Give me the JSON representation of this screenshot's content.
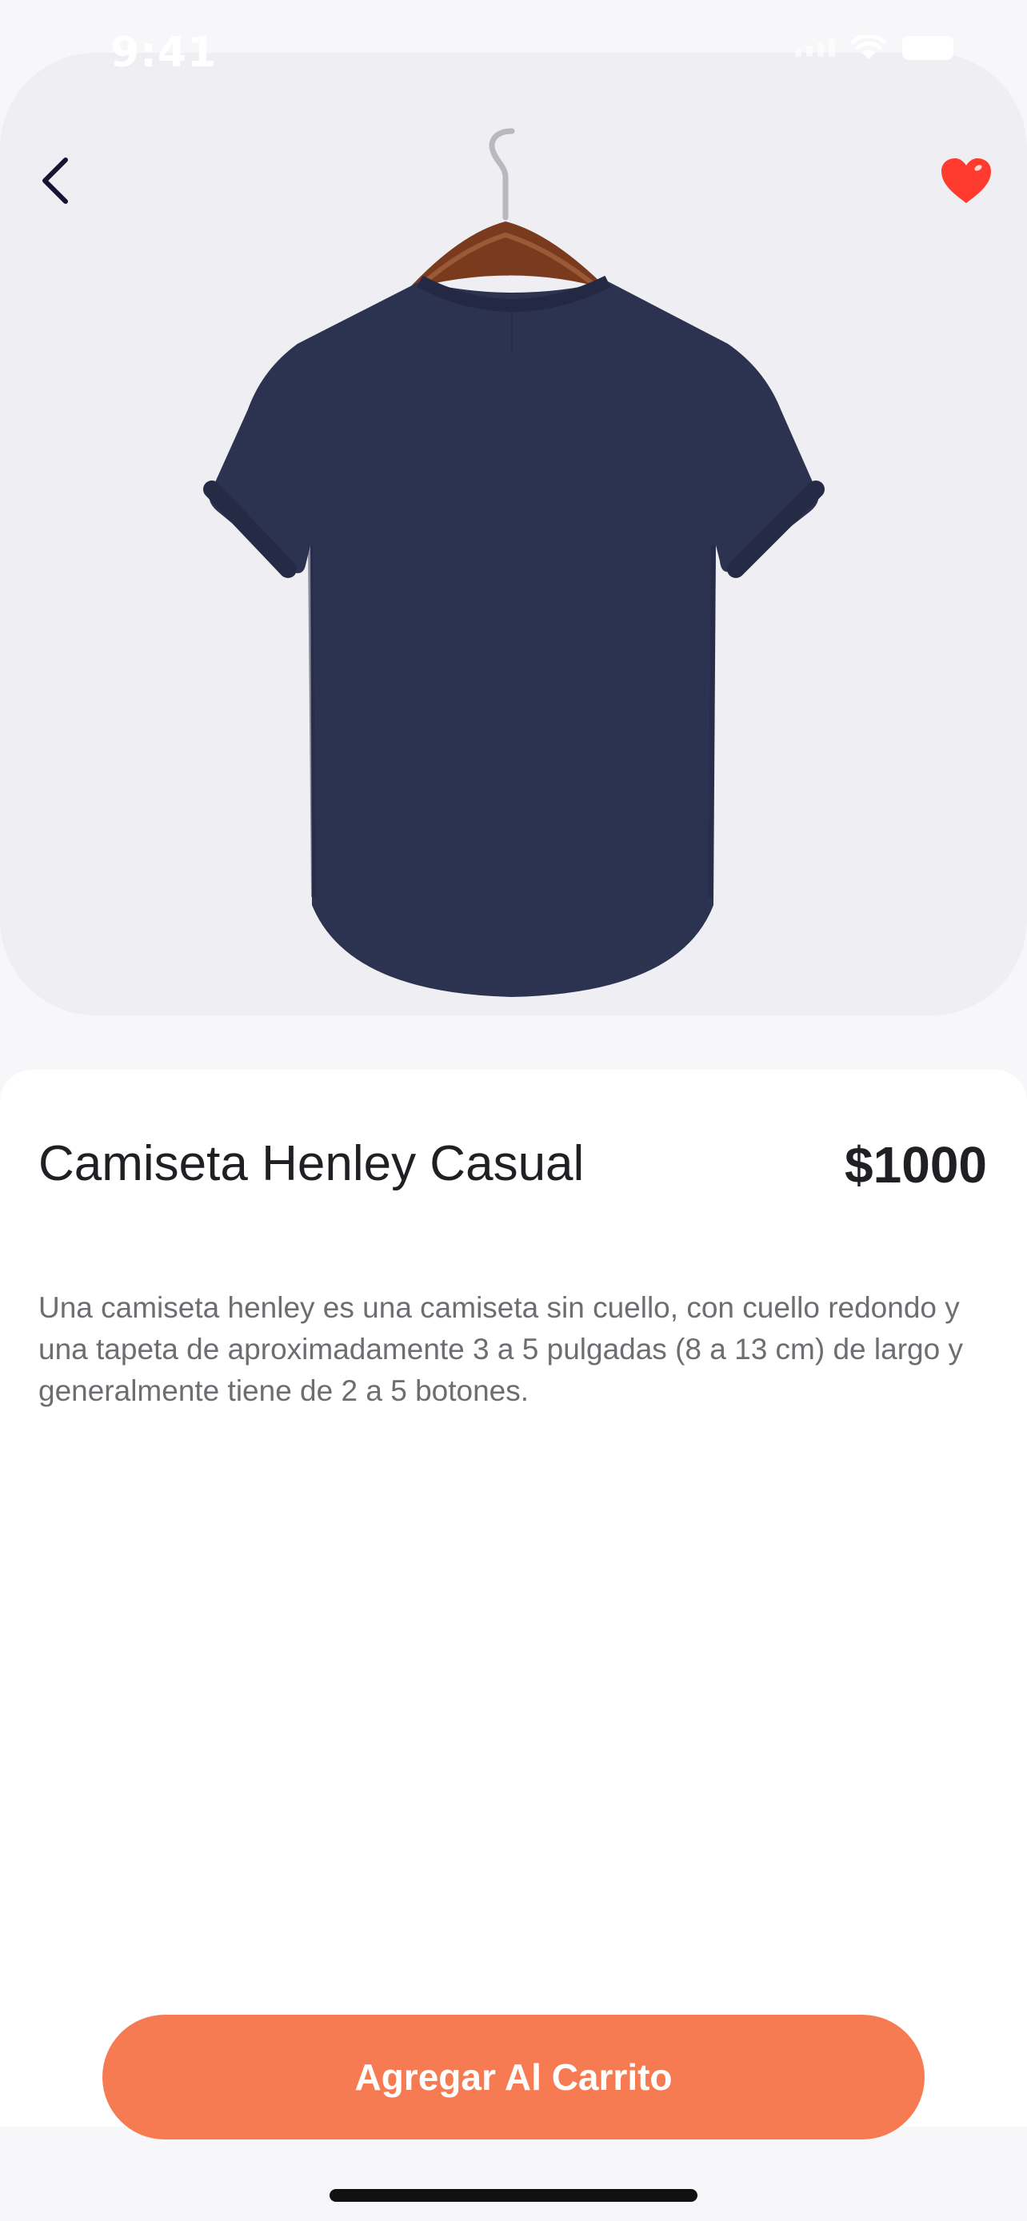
{
  "status_bar": {
    "time": "9:41"
  },
  "header": {
    "back_icon": "chevron-left-icon",
    "favorite_icon": "heart-icon",
    "favorite_color": "#ff3b30"
  },
  "product": {
    "name": "Camiseta Henley Casual",
    "price": "$1000",
    "description": "Una camiseta henley es una camiseta sin cuello, con cuello redondo y una tapeta de aproximadamente 3 a 5 pulgadas (8 a 13 cm) de largo y generalmente tiene de 2 a 5 botones."
  },
  "actions": {
    "add_to_cart_label": "Agregar Al Carrito"
  },
  "colors": {
    "accent": "#f77b52",
    "hero_bg": "#efeef2",
    "shirt": "#2c3350"
  }
}
